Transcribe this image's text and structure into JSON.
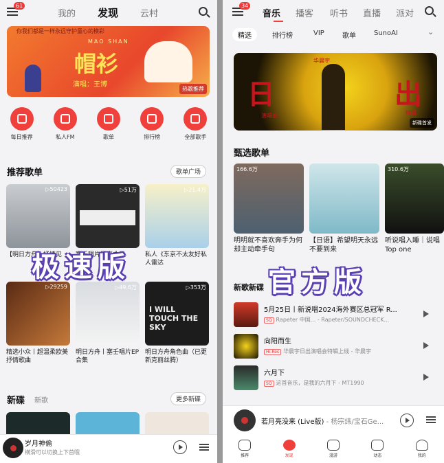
{
  "left": {
    "badge": "61",
    "tabs": [
      "我的",
      "发现",
      "云村"
    ],
    "banner": {
      "top_text": "你我们都是一样永远守护童心的模彩",
      "pinyin": "MAO SHAN",
      "title": "帽衫",
      "artist": "演唱：王博",
      "tag": "热歌推荐"
    },
    "nav": [
      "每日推荐",
      "私人FM",
      "歌单",
      "排行榜",
      "全部歌手"
    ],
    "playlists_title": "推荐歌单",
    "playlists_more": "歌单广场",
    "playlists": [
      {
        "count": "▷50423",
        "caption": "【明日方舟】抒情见"
      },
      {
        "count": "▷51万",
        "caption": "塞壬唱片原声曲目"
      },
      {
        "count": "▷21.4万",
        "caption": "私人《东京不太友好私人雷达"
      },
      {
        "count": "▷29259",
        "caption": "精选小众丨超温柔欧美抒情歌曲"
      },
      {
        "count": "▷49.6万",
        "caption": "明日方舟丨塞壬唱片EP合集"
      },
      {
        "count": "▷353万",
        "caption": "明日方舟角色曲（已更新克丽丝腾）"
      }
    ],
    "album_cover_text": "I WILL TOUCH THE SKY",
    "watermark": "极速版",
    "new_title": "新碟",
    "new_sub": "新歌",
    "new_more": "更多新碟",
    "mini_title": "岁月神偷",
    "mini_sub": "横滑可以切换上下首哦"
  },
  "right": {
    "badge": "34",
    "tabs": [
      "音乐",
      "播客",
      "听书",
      "直播",
      "派对"
    ],
    "chips": [
      "精选",
      "排行榜",
      "VIP",
      "歌单",
      "SunoAI"
    ],
    "banner": {
      "left": "日",
      "right": "出",
      "name": "华晨宇",
      "sub1": "演唱会",
      "sub2": "特辑",
      "tag": "新碟首发"
    },
    "featured_title": "甄选歌单",
    "featured": [
      {
        "count": "166.6万",
        "caption": "明明就不喜欢奔手为何却主动牵手句"
      },
      {
        "count": "",
        "caption": "【日语】希望明天永远不要到来"
      },
      {
        "count": "310.6万",
        "caption": "听说唱入睡｜说唱Top one"
      }
    ],
    "watermark": "官方版",
    "new_title": "新歌新碟",
    "songs": [
      {
        "title": "5月25日丨新说唱2024海外赛区总冠军 R...",
        "tag": "SQ",
        "sub": "Rapeter 中国... - Rapeter/SOUNDCHECK..."
      },
      {
        "title": "向阳而生",
        "tag": "Hi-Res",
        "sub": "华晨宇日出演唱会特辑上线 - 华晨宇"
      },
      {
        "title": "六月下",
        "tag": "SQ",
        "sub": "这首音乐，是我的六月下 - MT1990"
      }
    ],
    "mini_title": "若月亮没来 (Live版)",
    "mini_sub": " - 杨宗纬/宝石Ge...",
    "bottom_nav": [
      "推荐",
      "发现",
      "漫游",
      "动态",
      "我的"
    ]
  },
  "colors": {
    "accent": "#f0403c",
    "watermark_outline": "#5a3fb0"
  }
}
